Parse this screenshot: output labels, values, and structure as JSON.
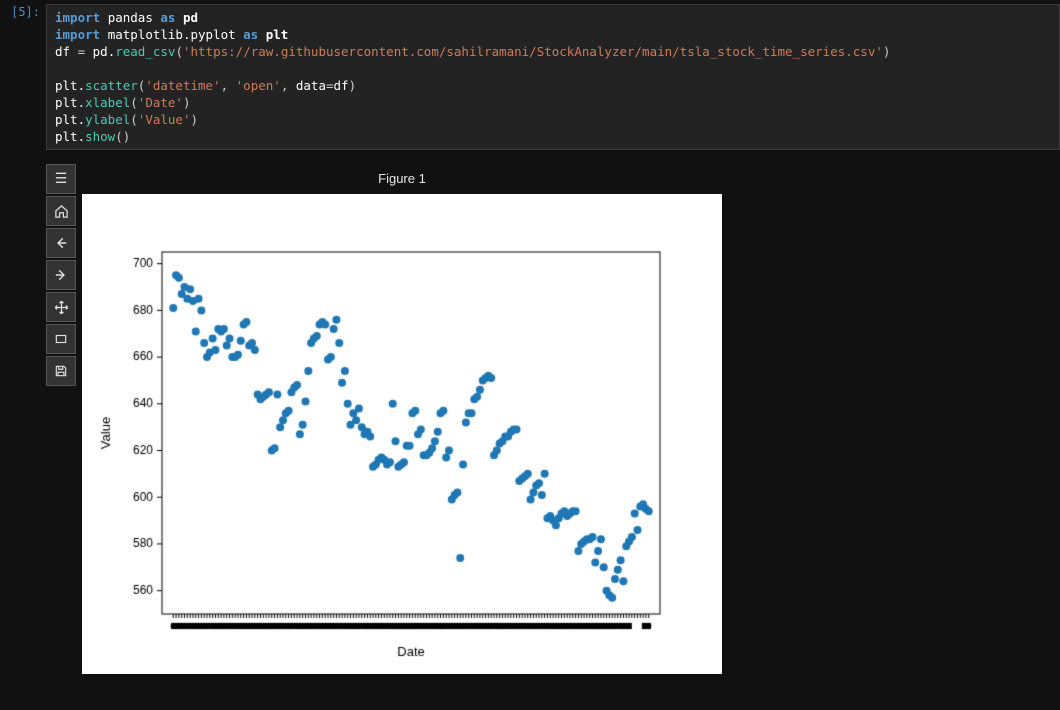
{
  "prompt": "[5]:",
  "code": {
    "l1": {
      "kw1": "import",
      "mod1": "pandas",
      "kw2": "as",
      "alias1": "pd"
    },
    "l2": {
      "kw1": "import",
      "mod1": "matplotlib.pyplot",
      "kw2": "as",
      "alias1": "plt"
    },
    "l3": {
      "var": "df",
      "eq": "=",
      "obj": "pd.",
      "fn": "read_csv",
      "lp": "(",
      "str": "'https://raw.githubusercontent.com/sahilramani/StockAnalyzer/main/tsla_stock_time_series.csv'",
      "rp": ")"
    },
    "l4": {
      "obj": "plt.",
      "fn": "scatter",
      "lp": "(",
      "s1": "'datetime'",
      "c1": ", ",
      "s2": "'open'",
      "c2": ", ",
      "kw": "data",
      "eq": "=",
      "v": "df",
      "rp": ")"
    },
    "l5": {
      "obj": "plt.",
      "fn": "xlabel",
      "lp": "(",
      "s1": "'Date'",
      "rp": ")"
    },
    "l6": {
      "obj": "plt.",
      "fn": "ylabel",
      "lp": "(",
      "s1": "'Value'",
      "rp": ")"
    },
    "l7": {
      "obj": "plt.",
      "fn": "show",
      "lp": "(",
      "rp": ")"
    }
  },
  "toolbar_icons": {
    "menu": "menu-icon",
    "home": "home-icon",
    "back": "arrow-left-icon",
    "forward": "arrow-right-icon",
    "pan": "move-icon",
    "zoom": "zoom-rect-icon",
    "save": "save-icon"
  },
  "figure_title": "Figure 1",
  "chart_data": {
    "type": "scatter",
    "title": "",
    "xlabel": "Date",
    "ylabel": "Value",
    "ylim": [
      550,
      705
    ],
    "yticks": [
      560,
      580,
      600,
      620,
      640,
      660,
      680,
      700
    ],
    "x": [
      0,
      1,
      2,
      3,
      4,
      5,
      6,
      7,
      8,
      9,
      10,
      11,
      12,
      13,
      14,
      15,
      16,
      17,
      18,
      19,
      20,
      21,
      22,
      23,
      24,
      25,
      26,
      27,
      28,
      29,
      30,
      31,
      32,
      33,
      34,
      35,
      36,
      37,
      38,
      39,
      40,
      41,
      42,
      43,
      44,
      45,
      46,
      47,
      48,
      49,
      50,
      51,
      52,
      53,
      54,
      55,
      56,
      57,
      58,
      59,
      60,
      61,
      62,
      63,
      64,
      65,
      66,
      67,
      68,
      69,
      70,
      71,
      72,
      73,
      74,
      75,
      76,
      77,
      78,
      79,
      80,
      81,
      82,
      83,
      84,
      85,
      86,
      87,
      88,
      89,
      90,
      91,
      92,
      93,
      94,
      95,
      96,
      97,
      98,
      99,
      100,
      101,
      102,
      103,
      104,
      105,
      106,
      107,
      108,
      109,
      110,
      111,
      112,
      113,
      114,
      115,
      116,
      117,
      118,
      119,
      120,
      121,
      122,
      123,
      124,
      125,
      126,
      127,
      128,
      129,
      130,
      131,
      132,
      133,
      134,
      135,
      136,
      137,
      138,
      139,
      140,
      141,
      142,
      143,
      144,
      145,
      146,
      147,
      148,
      149,
      150,
      151,
      152,
      153,
      154,
      155,
      156,
      157,
      158,
      159,
      160,
      161,
      162,
      163,
      164,
      165,
      166,
      167,
      168,
      169
    ],
    "y": [
      681,
      695,
      694,
      687,
      690,
      685,
      689,
      684,
      671,
      685,
      680,
      666,
      660,
      662,
      668,
      663,
      672,
      671,
      672,
      665,
      668,
      660,
      660,
      661,
      667,
      674,
      675,
      665,
      666,
      663,
      644,
      642,
      643,
      644,
      645,
      620,
      621,
      644,
      630,
      633,
      636,
      637,
      645,
      647,
      648,
      627,
      631,
      641,
      654,
      666,
      668,
      669,
      674,
      675,
      674,
      659,
      660,
      672,
      676,
      666,
      649,
      654,
      640,
      631,
      636,
      633,
      638,
      630,
      627,
      628,
      626,
      613,
      614,
      616,
      617,
      616,
      614,
      615,
      640,
      624,
      613,
      614,
      615,
      622,
      622,
      636,
      637,
      627,
      629,
      618,
      618,
      619,
      621,
      624,
      628,
      636,
      637,
      617,
      620,
      599,
      601,
      602,
      574,
      614,
      632,
      636,
      636,
      642,
      643,
      646,
      650,
      651,
      652,
      651,
      618,
      620,
      623,
      624,
      626,
      626,
      628,
      629,
      629,
      607,
      608,
      609,
      610,
      599,
      602,
      605,
      606,
      601,
      610,
      591,
      592,
      590,
      588,
      591,
      593,
      594,
      592,
      593,
      594,
      594,
      577,
      580,
      581,
      582,
      582,
      583,
      572,
      577,
      582,
      570,
      560,
      558,
      557,
      565,
      569,
      573,
      564,
      579,
      581,
      583,
      593,
      586,
      596,
      597,
      595,
      594
    ],
    "xlim": [
      -4,
      173
    ],
    "point_color": "#1f77b4"
  }
}
